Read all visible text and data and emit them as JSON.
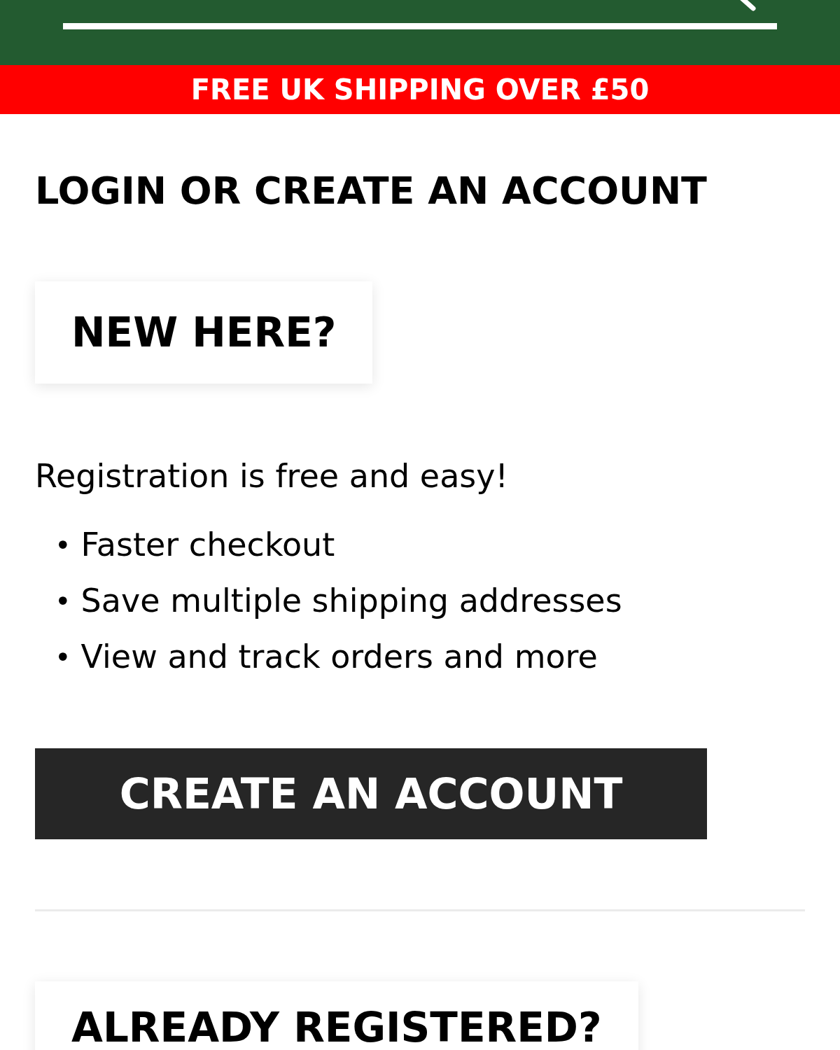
{
  "banner": {
    "text": "FREE UK SHIPPING OVER £50"
  },
  "title": "LOGIN OR CREATE AN ACCOUNT",
  "new_customer": {
    "heading": "NEW HERE?",
    "intro": "Registration is free and easy!",
    "benefits": [
      {
        "bullet": "•",
        "text": "Faster checkout"
      },
      {
        "bullet": "•",
        "text": "Save multiple shipping addresses"
      },
      {
        "bullet": "•",
        "text": "View and track orders and more"
      }
    ],
    "button": "CREATE AN ACCOUNT"
  },
  "returning_customer": {
    "heading": "ALREADY REGISTERED?"
  }
}
